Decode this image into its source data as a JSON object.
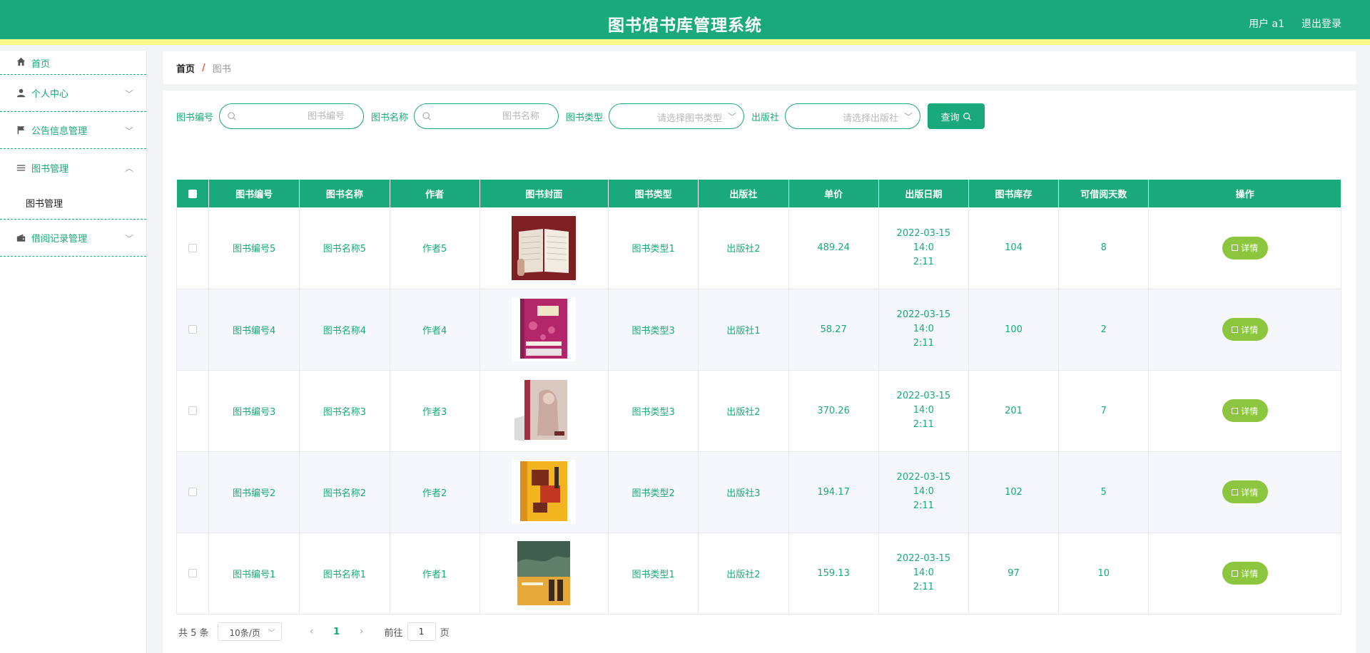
{
  "header": {
    "title": "图书馆书库管理系统",
    "user_label": "用户 a1",
    "logout_label": "退出登录"
  },
  "sidebar": {
    "items": [
      {
        "label": "首页",
        "icon": "home-icon"
      },
      {
        "label": "个人中心",
        "icon": "user-icon"
      },
      {
        "label": "公告信息管理",
        "icon": "flag-icon"
      },
      {
        "label": "图书管理",
        "icon": "list-icon"
      },
      {
        "label": "借阅记录管理",
        "icon": "wallet-icon"
      }
    ],
    "submenu": {
      "label": "图书管理"
    }
  },
  "breadcrumb": {
    "home": "首页",
    "separator": "/",
    "current": "图书"
  },
  "search": {
    "book_no_label": "图书编号",
    "book_no_placeholder": "图书编号",
    "book_name_label": "图书名称",
    "book_name_placeholder": "图书名称",
    "book_type_label": "图书类型",
    "book_type_placeholder": "请选择图书类型",
    "publisher_label": "出版社",
    "publisher_placeholder": "请选择出版社",
    "query_label": "查询"
  },
  "table": {
    "headers": [
      "图书编号",
      "图书名称",
      "作者",
      "图书封面",
      "图书类型",
      "出版社",
      "单价",
      "出版日期",
      "图书库存",
      "可借阅天数",
      "操作"
    ],
    "rows": [
      {
        "no": "图书编号5",
        "name": "图书名称5",
        "author": "作者5",
        "type": "图书类型1",
        "publisher": "出版社2",
        "price": "489.24",
        "date_a": "2022-03-15 14:0",
        "date_b": "2:11",
        "stock": "104",
        "days": "8",
        "action": "详情"
      },
      {
        "no": "图书编号4",
        "name": "图书名称4",
        "author": "作者4",
        "type": "图书类型3",
        "publisher": "出版社1",
        "price": "58.27",
        "date_a": "2022-03-15 14:0",
        "date_b": "2:11",
        "stock": "100",
        "days": "2",
        "action": "详情"
      },
      {
        "no": "图书编号3",
        "name": "图书名称3",
        "author": "作者3",
        "type": "图书类型3",
        "publisher": "出版社2",
        "price": "370.26",
        "date_a": "2022-03-15 14:0",
        "date_b": "2:11",
        "stock": "201",
        "days": "7",
        "action": "详情"
      },
      {
        "no": "图书编号2",
        "name": "图书名称2",
        "author": "作者2",
        "type": "图书类型2",
        "publisher": "出版社3",
        "price": "194.17",
        "date_a": "2022-03-15 14:0",
        "date_b": "2:11",
        "stock": "102",
        "days": "5",
        "action": "详情"
      },
      {
        "no": "图书编号1",
        "name": "图书名称1",
        "author": "作者1",
        "type": "图书类型1",
        "publisher": "出版社2",
        "price": "159.13",
        "date_a": "2022-03-15 14:0",
        "date_b": "2:11",
        "stock": "97",
        "days": "10",
        "action": "详情"
      }
    ]
  },
  "pagination": {
    "total": "共 5 条",
    "page_size": "10条/页",
    "prev": "‹",
    "current_page": "1",
    "next": "›",
    "goto_label": "前往",
    "goto_value": "1",
    "goto_unit": "页"
  },
  "colors": {
    "primary": "#1aa97a",
    "header_stripe": "#f6f98a",
    "detail_button": "#8cc63f"
  }
}
